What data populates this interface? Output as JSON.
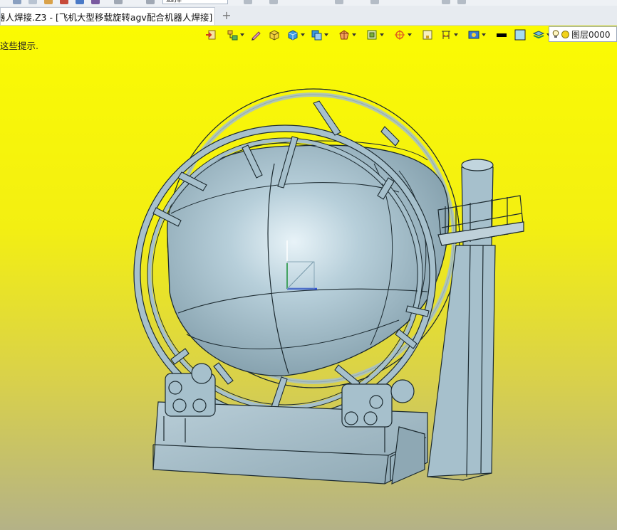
{
  "quick_access": {
    "selector_value": "选择"
  },
  "tab": {
    "title": "器人焊接.Z3 - [飞机大型移载旋转agv配合机器人焊接]",
    "close_glyph": "✕",
    "new_tab_glyph": "+"
  },
  "viewport": {
    "hint_text": "这些提示.",
    "background_top": "#fbfb02",
    "background_bottom": "#b4b287",
    "model_color": "#a6c0cc",
    "edge_color": "#1c2a30"
  },
  "view_toolbar": {
    "icons": [
      "exit-icon",
      "assembly-tree-icon",
      "pencil-icon",
      "shaded-cube-icon",
      "cube-view-icon",
      "display-mode-icon",
      "section-icon",
      "frame-icon",
      "pivot-icon",
      "fit-view-icon",
      "measure-icon",
      "filter-icon",
      "line-color-icon",
      "fill-color-icon",
      "material-icon"
    ],
    "layer_label": "图层0000"
  }
}
